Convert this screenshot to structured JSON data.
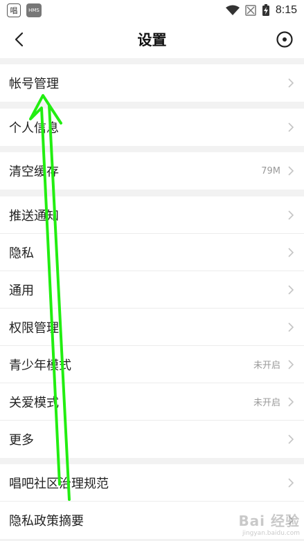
{
  "status_bar": {
    "app_icon_text": "唱",
    "hms_text": "HMS",
    "time": "8:15"
  },
  "header": {
    "title": "设置",
    "back_icon": "chevron-left-icon",
    "right_icon": "record-circle-icon"
  },
  "groups": [
    {
      "items": [
        {
          "label": "帐号管理",
          "value": ""
        }
      ]
    },
    {
      "items": [
        {
          "label": "个人信息",
          "value": ""
        }
      ]
    },
    {
      "items": [
        {
          "label": "清空缓存",
          "value": "79M"
        }
      ]
    },
    {
      "items": [
        {
          "label": "推送通知",
          "value": ""
        },
        {
          "label": "隐私",
          "value": ""
        },
        {
          "label": "通用",
          "value": ""
        },
        {
          "label": "权限管理",
          "value": ""
        },
        {
          "label": "青少年模式",
          "value": "未开启"
        },
        {
          "label": "关爱模式",
          "value": "未开启"
        },
        {
          "label": "更多",
          "value": ""
        }
      ]
    },
    {
      "items": [
        {
          "label": "唱吧社区治理规范",
          "value": ""
        },
        {
          "label": "隐私政策摘要",
          "value": ""
        }
      ]
    }
  ],
  "watermark": {
    "logo": "Bai 经验",
    "url": "jingyan.baidu.com"
  },
  "colors": {
    "annotation_arrow": "#22ee11",
    "chevron": "#c4c4c4",
    "secondary_text": "#999999"
  }
}
